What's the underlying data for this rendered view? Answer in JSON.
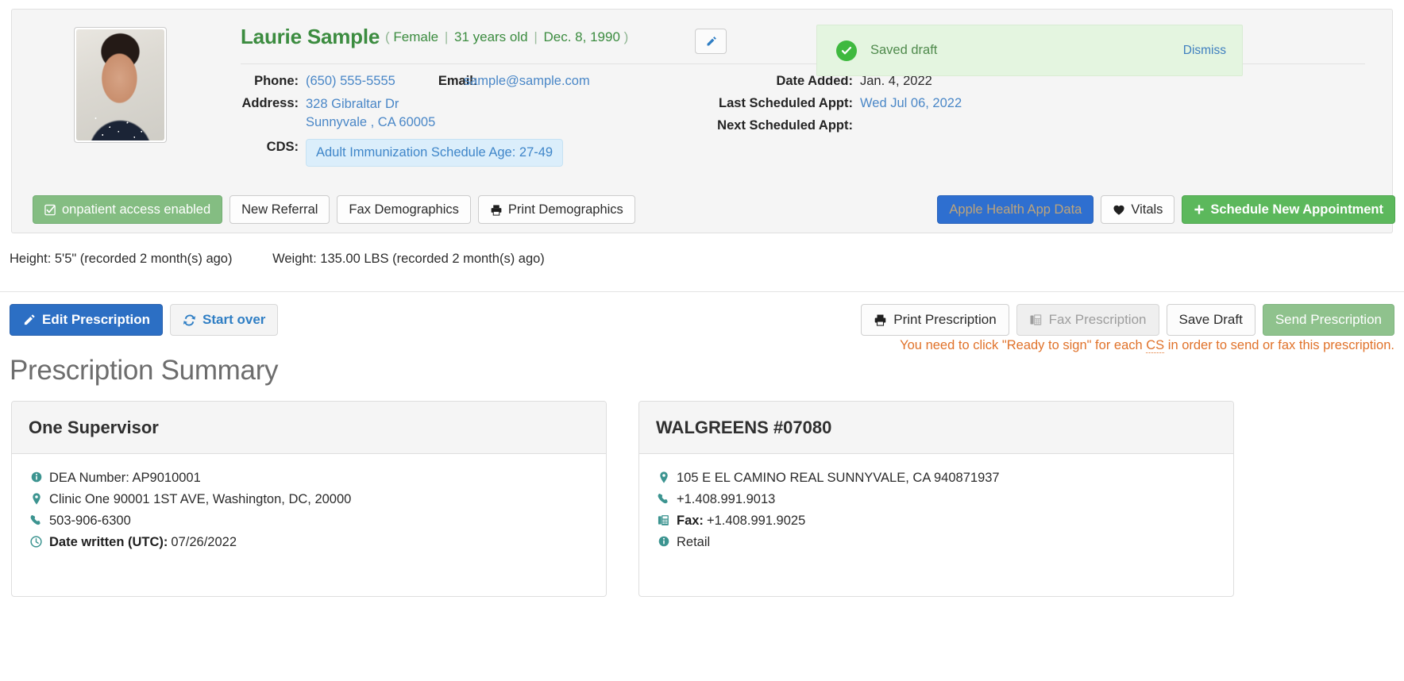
{
  "patient": {
    "name": "Laurie Sample",
    "meta_open_paren": "(",
    "sex": "Female",
    "age": "31 years old",
    "dob": "Dec. 8, 1990",
    "meta_close_paren": ")",
    "edit_icon": "pencil-icon",
    "labels": {
      "phone": "Phone:",
      "email": "Email:",
      "address": "Address:",
      "cds": "CDS:",
      "date_added": "Date Added:",
      "last_appt": "Last Scheduled Appt:",
      "next_appt": "Next Scheduled Appt:"
    },
    "phone": "(650) 555-5555",
    "email": "sample@sample.com",
    "address_line1": "328 Gibraltar Dr",
    "address_line2": "Sunnyvale , CA 60005",
    "cds_badge": "Adult Immunization Schedule Age: 27-49",
    "date_added": "Jan. 4, 2022",
    "last_scheduled_appt": "Wed Jul 06, 2022",
    "next_scheduled_appt": ""
  },
  "toast": {
    "icon": "check-circle-icon",
    "message": "Saved draft",
    "dismiss_label": "Dismiss",
    "bg_color": "#e4f5e0",
    "check_color": "#3fb93f"
  },
  "action_buttons": [
    {
      "label": "onpatient access enabled",
      "icon": "checkbox-checked-icon",
      "style": "success"
    },
    {
      "label": "New Referral",
      "icon": "",
      "style": "default"
    },
    {
      "label": "Fax Demographics",
      "icon": "",
      "style": "default"
    },
    {
      "label": "Print Demographics",
      "icon": "printer-icon",
      "style": "default"
    },
    {
      "label": "Apple Health App Data",
      "icon": "",
      "style": "blue"
    },
    {
      "label": "Vitals",
      "icon": "heart-icon",
      "style": "default"
    },
    {
      "label": "Schedule New Appointment",
      "icon": "plus-icon",
      "style": "green"
    }
  ],
  "vitals": {
    "height": "Height: 5'5\" (recorded 2 month(s) ago)",
    "weight": "Weight: 135.00 LBS (recorded 2 month(s) ago)"
  },
  "rx_toolbar": {
    "edit_prescription": "Edit Prescription",
    "edit_icon": "pencil-icon",
    "start_over": "Start over",
    "start_over_icon": "refresh-icon",
    "print_prescription": "Print Prescription",
    "print_icon": "printer-icon",
    "fax_prescription": "Fax Prescription",
    "fax_icon": "fax-icon",
    "save_draft": "Save Draft",
    "send_prescription": "Send Prescription",
    "warning_before": "You need to click \"Ready to sign\" for each ",
    "warning_abbr": "CS",
    "warning_after": " in order to send or fax this prescription.",
    "warning_color": "#e0722a"
  },
  "page_heading": "Prescription Summary",
  "cards": [
    {
      "title": "One Supervisor",
      "lines": [
        {
          "icon": "info-circle-icon",
          "bold": "",
          "text": "DEA Number: AP9010001"
        },
        {
          "icon": "map-marker-icon",
          "bold": "",
          "text": "Clinic One 90001 1ST AVE, Washington, DC, 20000"
        },
        {
          "icon": "phone-icon",
          "bold": "",
          "text": "503-906-6300"
        },
        {
          "icon": "clock-icon",
          "bold": "Date written (UTC):",
          "text": "07/26/2022"
        }
      ]
    },
    {
      "title": "WALGREENS #07080",
      "lines": [
        {
          "icon": "map-marker-icon",
          "bold": "",
          "text": "105 E EL CAMINO REAL SUNNYVALE, CA 940871937"
        },
        {
          "icon": "phone-icon",
          "bold": "",
          "text": "+1.408.991.9013"
        },
        {
          "icon": "fax-icon",
          "bold": "Fax:",
          "text": "+1.408.991.9025"
        },
        {
          "icon": "info-circle-icon",
          "bold": "",
          "text": "Retail"
        }
      ]
    }
  ],
  "colors": {
    "patient_name_green": "#3c8c40",
    "link_blue": "#3f7fbf",
    "icon_teal": "#3c9490",
    "warning_orange": "#e0722a"
  }
}
